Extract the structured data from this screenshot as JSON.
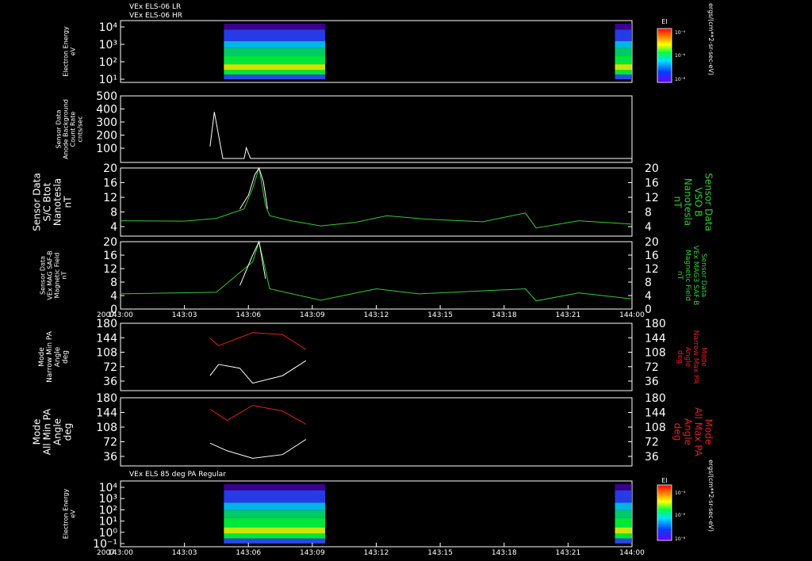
{
  "titles": {
    "top_line1": "VEx ELS-06 LR",
    "top_line2": "VEx ELS-06 HR",
    "bottom": "VEx ELS 85 deg PA Regular"
  },
  "time_axis": {
    "year": "2007",
    "ticks": [
      "143:00",
      "143:03",
      "143:06",
      "143:09",
      "143:12",
      "143:15",
      "143:18",
      "143:21",
      "144:00"
    ]
  },
  "colorbar": {
    "label": "EI",
    "unit": "ergs/(cm**2-sr-sec-eV)",
    "ticks": [
      "10⁻⁴",
      "10⁻⁶",
      "10⁻⁸"
    ]
  },
  "panels": [
    {
      "id": "p1",
      "left_label": [
        "Electron Energy",
        "eV"
      ],
      "yticks": [
        "10⁴",
        "10³",
        "10²",
        "10¹"
      ],
      "type": "spectrogram"
    },
    {
      "id": "p2",
      "left_label": [
        "Sensor Data",
        "Anode Background",
        "Count Rate",
        "cnts/sec"
      ],
      "yticks": [
        "500",
        "400",
        "300",
        "200",
        "100"
      ],
      "type": "line"
    },
    {
      "id": "p3",
      "left_label": [
        "Sensor Data",
        "S/C Btot",
        "Nanotesla",
        "nT"
      ],
      "right_label": [
        "Sensor Data",
        "VSO B",
        "Nanotesla",
        "nT"
      ],
      "yticks": [
        "20",
        "16",
        "12",
        "8",
        "4"
      ],
      "type": "line"
    },
    {
      "id": "p4",
      "left_label": [
        "Sensor Data",
        "VEx MAG SAF-B",
        "Magnetic Field",
        "nT"
      ],
      "right_label": [
        "Sensor Data",
        "VEx MAG3 SAF-B",
        "Magnetic Field",
        "nT"
      ],
      "yticks": [
        "20",
        "16",
        "12",
        "8",
        "4",
        "0"
      ],
      "type": "line"
    },
    {
      "id": "p5",
      "left_label": [
        "Mode",
        "Narrow Min PA",
        "Angle",
        "deg"
      ],
      "right_label": [
        "Mode",
        "Narrow Max PA",
        "Angle",
        "deg"
      ],
      "yticks": [
        "180",
        "144",
        "108",
        "72",
        "36"
      ],
      "type": "line"
    },
    {
      "id": "p6",
      "left_label": [
        "Mode",
        "All Min PA",
        "Angle",
        "deg"
      ],
      "right_label": [
        "Mode",
        "All Max PA",
        "Angle",
        "deg"
      ],
      "yticks": [
        "180",
        "144",
        "108",
        "72",
        "36"
      ],
      "type": "line"
    },
    {
      "id": "p7",
      "left_label": [
        "Electron Energy",
        "eV"
      ],
      "yticks": [
        "10⁴",
        "10³",
        "10²",
        "10¹",
        "10⁰",
        "10⁻¹"
      ],
      "type": "spectrogram"
    }
  ],
  "chart_data": [
    {
      "type": "heatmap",
      "title": "VEx ELS-06 LR / VEx ELS-06 HR",
      "ylabel": "Electron Energy eV",
      "y_scale": "log",
      "ylim": [
        1,
        10000
      ],
      "x_range": [
        "143:00",
        "144:00"
      ],
      "data_intervals": [
        [
          "143:04.2",
          "143:08.8"
        ],
        [
          "143:22.3",
          "144:00"
        ]
      ]
    },
    {
      "type": "line",
      "ylabel": "Sensor Data Anode Background Count Rate cnts/sec",
      "ylim": [
        0,
        500
      ],
      "series": [
        {
          "color": "#ffffff",
          "points": [
            [
              4.2,
              120
            ],
            [
              4.4,
              380
            ],
            [
              4.8,
              30
            ],
            [
              5.8,
              30
            ],
            [
              5.9,
              110
            ],
            [
              6.1,
              30
            ],
            [
              8.8,
              30
            ],
            [
              22.3,
              30
            ],
            [
              24,
              30
            ]
          ]
        }
      ]
    },
    {
      "type": "line",
      "ylabel": "Sensor Data S/C Btot Nanotesla nT",
      "ylim": [
        0,
        20
      ],
      "series": [
        {
          "name": "VSO B",
          "color": "#33cc33",
          "points": [
            [
              0,
              4.5
            ],
            [
              3,
              4.4
            ],
            [
              4.5,
              5.2
            ],
            [
              5.8,
              8
            ],
            [
              6.2,
              14
            ],
            [
              6.5,
              20
            ],
            [
              6.8,
              9
            ],
            [
              7,
              6
            ],
            [
              8,
              4.5
            ],
            [
              9.4,
              3
            ],
            [
              11,
              4
            ],
            [
              12.5,
              6
            ],
            [
              14.3,
              5
            ],
            [
              17,
              4.2
            ],
            [
              19,
              6.8
            ],
            [
              19.5,
              2.4
            ],
            [
              21.5,
              4.5
            ],
            [
              24,
              3.5
            ]
          ]
        },
        {
          "name": "Btot",
          "color": "#ffffff",
          "points": [
            [
              5.6,
              8
            ],
            [
              6.0,
              12
            ],
            [
              6.3,
              18
            ],
            [
              6.5,
              20
            ],
            [
              6.7,
              16
            ],
            [
              6.9,
              8
            ]
          ]
        }
      ]
    },
    {
      "type": "line",
      "ylabel": "Sensor Data VEx MAG SAF-B Magnetic Field nT",
      "ylim": [
        0,
        20
      ],
      "series": [
        {
          "color": "#33cc33",
          "points": [
            [
              0,
              4.5
            ],
            [
              4.5,
              5
            ],
            [
              6.2,
              14
            ],
            [
              6.5,
              20
            ],
            [
              7,
              6
            ],
            [
              9.4,
              2.6
            ],
            [
              12,
              6
            ],
            [
              14,
              4.5
            ],
            [
              19,
              6
            ],
            [
              19.5,
              2.4
            ],
            [
              21.5,
              4.8
            ],
            [
              24,
              3
            ]
          ]
        },
        {
          "color": "#ffffff",
          "points": [
            [
              5.6,
              7
            ],
            [
              6.2,
              16
            ],
            [
              6.5,
              20
            ],
            [
              6.8,
              9
            ]
          ]
        }
      ]
    },
    {
      "type": "line",
      "ylabel": "Mode Narrow Min PA Angle deg",
      "ylim": [
        0,
        180
      ],
      "series": [
        {
          "name": "Min PA",
          "color": "#ffffff",
          "points": [
            [
              4.2,
              40
            ],
            [
              4.6,
              70
            ],
            [
              5.6,
              60
            ],
            [
              6.2,
              20
            ],
            [
              7.6,
              40
            ],
            [
              8.7,
              80
            ]
          ]
        },
        {
          "name": "Max PA",
          "color": "#dd2222",
          "points": [
            [
              4.2,
              140
            ],
            [
              4.6,
              120
            ],
            [
              6.2,
              155
            ],
            [
              7.6,
              150
            ],
            [
              8.7,
              110
            ]
          ]
        }
      ]
    },
    {
      "type": "line",
      "ylabel": "Mode All Min PA Angle deg",
      "ylim": [
        0,
        180
      ],
      "series": [
        {
          "name": "Min PA",
          "color": "#ffffff",
          "points": [
            [
              4.2,
              60
            ],
            [
              5,
              40
            ],
            [
              6.2,
              20
            ],
            [
              7.6,
              30
            ],
            [
              8.7,
              70
            ]
          ]
        },
        {
          "name": "Max PA",
          "color": "#dd2222",
          "points": [
            [
              4.2,
              150
            ],
            [
              5,
              120
            ],
            [
              6.2,
              160
            ],
            [
              7.6,
              145
            ],
            [
              8.7,
              110
            ]
          ]
        }
      ]
    },
    {
      "type": "heatmap",
      "title": "VEx ELS 85 deg PA Regular",
      "ylabel": "Electron Energy eV",
      "y_scale": "log",
      "ylim": [
        0.1,
        10000
      ],
      "x_range": [
        "143:00",
        "144:00"
      ],
      "data_intervals": [
        [
          "143:04.2",
          "143:08.8"
        ],
        [
          "143:22.3",
          "144:00"
        ]
      ]
    }
  ]
}
